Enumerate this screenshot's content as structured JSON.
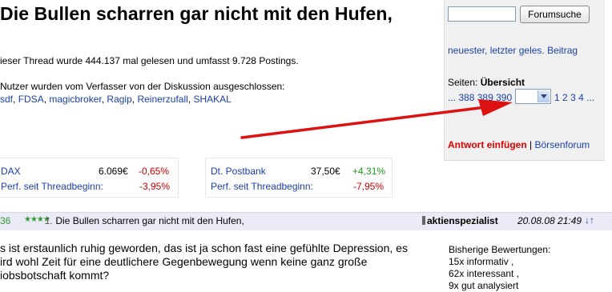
{
  "thread": {
    "title": "Die Bullen scharren gar nicht mit den Hufen,",
    "info": "ieser Thread wurde 444.137 mal gelesen und umfasst 9.728 Postings.",
    "excluded_intro": "Nutzer wurden vom Verfasser von der Diskussion ausgeschlossen:",
    "excluded_users": [
      "sdf",
      "FDSA",
      "magicbroker",
      "Ragip",
      "Reinerzufall",
      "SHAKAL"
    ]
  },
  "sidebar": {
    "search_placeholder": "",
    "search_button": "Forumsuche",
    "newest_link": "neuester, letzter geles. Beitrag",
    "pages_label": "Seiten: ",
    "overview_label": "Übersicht",
    "pages_ellipsis_start": "...",
    "pages_before": [
      "388",
      "389",
      "390"
    ],
    "pages_after": [
      "1",
      "2",
      "3",
      "4"
    ],
    "pages_ellipsis_end": "...",
    "reply_link": "Antwort einfügen",
    "separator": "|",
    "forum_link": "Börsenforum"
  },
  "stocks": [
    {
      "name": "DAX",
      "price": "6.069€",
      "change": "-0,65%",
      "perf_label": "Perf. seit Threadbeginn:",
      "perf_value": "-3,95%",
      "change_color": "#cc0000",
      "perf_color": "#cc0000"
    },
    {
      "name": "Dt. Postbank",
      "price": "37,50€",
      "change": "+4,31%",
      "perf_label": "Perf. seit Threadbeginn:",
      "perf_value": "-7,95%",
      "change_color": "#1d9a1d",
      "perf_color": "#cc0000"
    }
  ],
  "post": {
    "number": "36",
    "stars": "★★★★",
    "post_index": "1.",
    "title": "Die Bullen scharren gar nicht mit den Hufen,",
    "author": "aktienspezialist",
    "date": "20.08.08 21:49",
    "updown": "↓↑",
    "body_line1": "s ist erstaunlich ruhig geworden, das ist ja schon fast eine gefühlte Depression, es",
    "body_line2": "ird wohl Zeit für eine deutlichere Gegenbewegung wenn keine ganz große",
    "body_line3": "iobsbotschaft kommt?",
    "ratings_label": "Bisherige Bewertungen:",
    "ratings": [
      "15x informativ ,",
      "62x interessant ,",
      "9x gut analysiert"
    ]
  },
  "colors": {
    "link": "#1a3fa8",
    "negative": "#cc0000",
    "positive": "#1d9a1d",
    "header_bar": "#ebebf7",
    "sidebar_bg": "#f0f0f0",
    "annotation_arrow": "#dd1111"
  }
}
